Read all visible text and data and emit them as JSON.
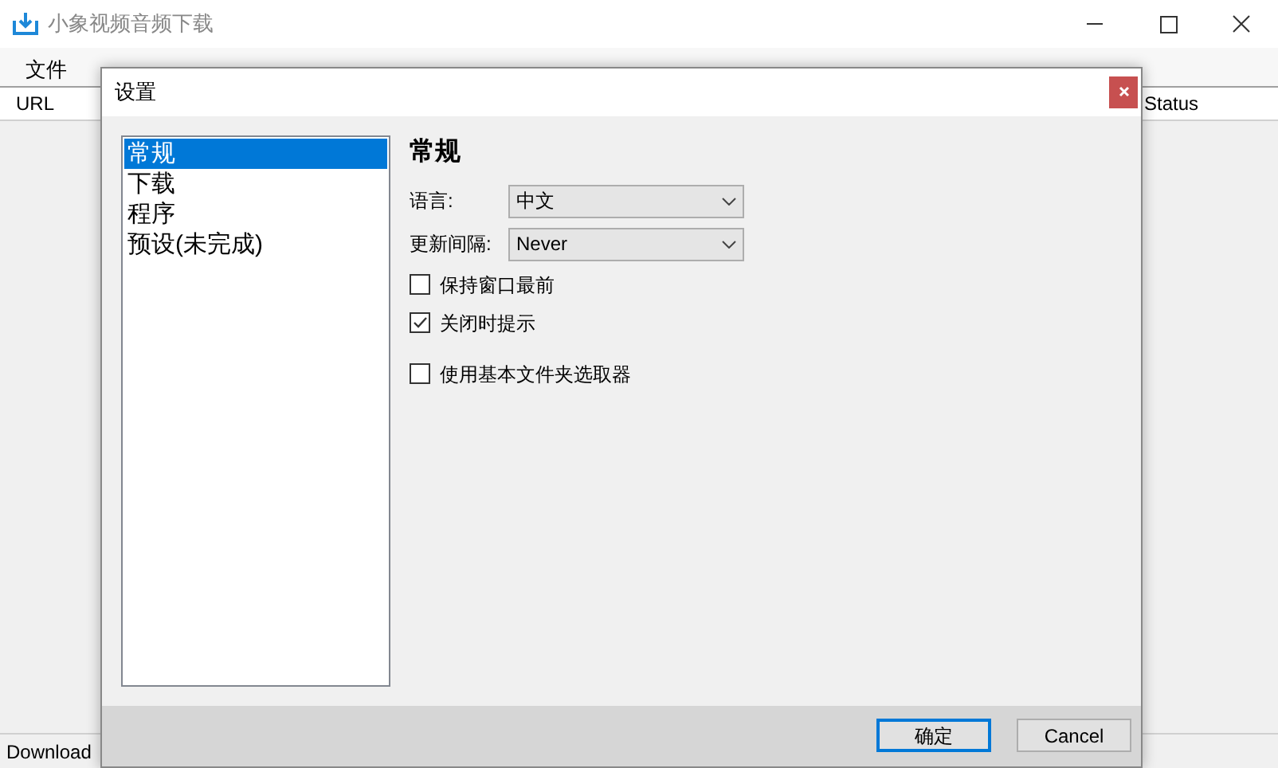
{
  "window": {
    "title": "小象视频音频下载"
  },
  "menu": [
    "文件"
  ],
  "table": {
    "columns": [
      "URL",
      "Status"
    ]
  },
  "status_bar": "Download",
  "dialog": {
    "title": "设置",
    "categories": [
      {
        "label": "常规",
        "selected": true
      },
      {
        "label": "下载",
        "selected": false
      },
      {
        "label": "程序",
        "selected": false
      },
      {
        "label": "预设(未完成)",
        "selected": false
      }
    ],
    "heading": "常规",
    "fields": [
      {
        "label": "语言:",
        "value": "中文"
      },
      {
        "label": "更新间隔:",
        "value": "Never"
      }
    ],
    "option_groups": [
      [
        {
          "label": "保持窗口最前",
          "checked": false
        },
        {
          "label": "关闭时提示",
          "checked": true
        }
      ],
      [
        {
          "label": "使用基本文件夹选取器",
          "checked": false
        }
      ]
    ],
    "buttons": [
      {
        "label": "确定",
        "default": true
      },
      {
        "label": "Cancel",
        "default": false
      }
    ]
  }
}
